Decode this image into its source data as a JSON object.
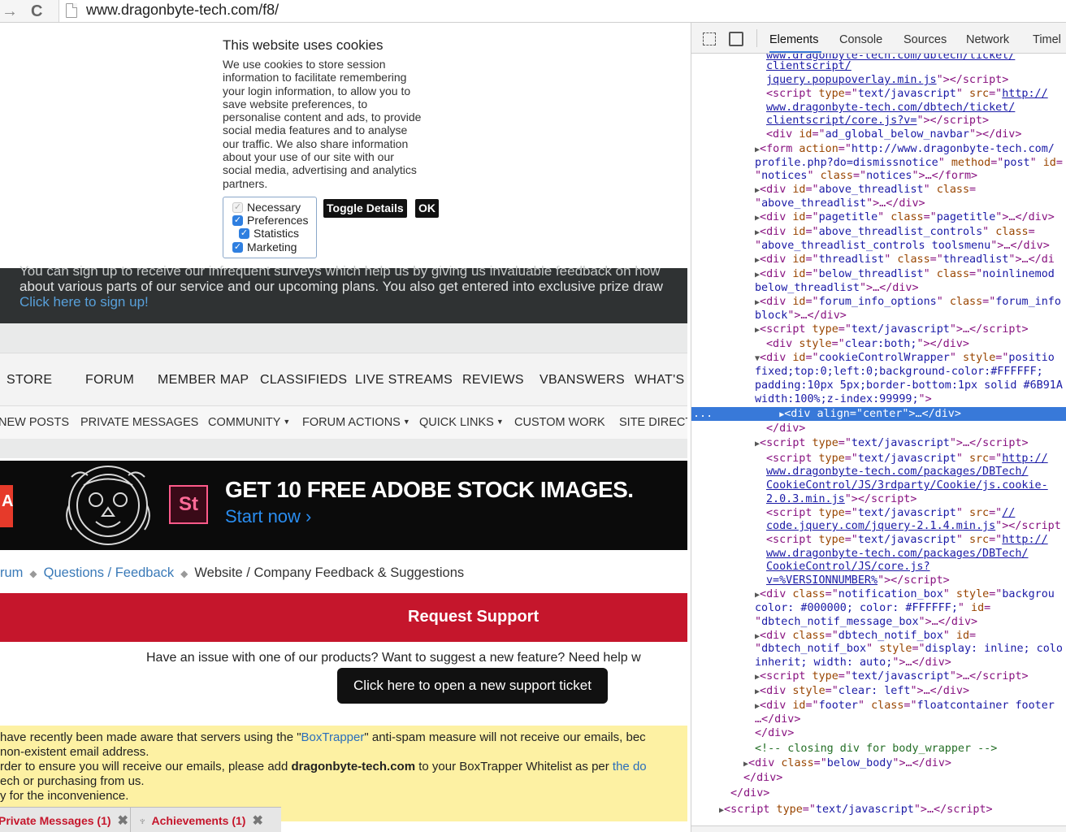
{
  "browser": {
    "url": "www.dragonbyte-tech.com/f8/",
    "back": "→",
    "reload": "C"
  },
  "cookie": {
    "title": "This website uses cookies",
    "text_lines": [
      "We use cookies to store session",
      "information to facilitate remembering",
      "your login information, to allow you to",
      "save website preferences, to",
      "personalise content and ads, to provide",
      "social media features and to analyse",
      "our traffic. We also share information",
      "about your use of our site with our",
      "social media, advertising and analytics",
      "partners."
    ],
    "options": [
      {
        "label": "Necessary",
        "checked": true,
        "disabled": true
      },
      {
        "label": "Preferences",
        "checked": true,
        "disabled": false
      },
      {
        "label": "Statistics",
        "checked": true,
        "disabled": false
      },
      {
        "label": "Marketing",
        "checked": true,
        "disabled": false
      }
    ],
    "toggle_label": "Toggle Details",
    "ok_label": "OK"
  },
  "survey": {
    "line1": "You can sign up to receive our infrequent surveys which help us by giving us invaluable feedback on how",
    "line2": "about various parts of our service and our upcoming plans. You also get entered into exclusive prize draw",
    "link": "Click here to sign up!"
  },
  "nav_main": [
    "STORE",
    "FORUM",
    "MEMBER MAP",
    "CLASSIFIEDS",
    "LIVE STREAMS",
    "REVIEWS",
    "VBANSWERS",
    "WHAT'S N"
  ],
  "nav_sub": [
    {
      "label": "NEW POSTS",
      "caret": false
    },
    {
      "label": "PRIVATE MESSAGES",
      "caret": false
    },
    {
      "label": "COMMUNITY",
      "caret": true
    },
    {
      "label": "FORUM ACTIONS",
      "caret": true
    },
    {
      "label": "QUICK LINKS",
      "caret": true
    },
    {
      "label": "CUSTOM WORK",
      "caret": false
    },
    {
      "label": "SITE DIRECT",
      "caret": false
    }
  ],
  "banner": {
    "red_tile": "A",
    "st": "St",
    "headline": "GET 10 FREE ADOBE STOCK IMAGES.",
    "cta": "Start now ›"
  },
  "breadcrumb": {
    "first": "rum",
    "second": "Questions / Feedback",
    "current": "Website / Company Feedback & Suggestions"
  },
  "support": {
    "bar_label": "Request Support",
    "issue_text": "Have an issue with one of our products? Want to suggest a new feature? Need help w",
    "ticket_button": "Click here to open a new support ticket"
  },
  "notice": {
    "l1_a": "have recently been made aware that servers using the \"",
    "l1_link": "BoxTrapper",
    "l1_b": "\" anti-spam measure will not receive our emails, bec",
    "l2": "non-existent email address.",
    "l3_a": "rder to ensure you will receive our emails, please add ",
    "l3_bold": "dragonbyte-tech.com",
    "l3_b": " to your BoxTrapper Whitelist as per ",
    "l3_link": "the do",
    "l4": "ech or purchasing from us.",
    "l5": "y for the inconvenience."
  },
  "bottom_tabs": [
    {
      "label": "Private Messages (1)"
    },
    {
      "label": "Achievements (1)"
    }
  ],
  "devtools": {
    "tabs": [
      "Elements",
      "Console",
      "Sources",
      "Network",
      "Timel"
    ],
    "active_tab": "Elements",
    "selected_marker": "..."
  }
}
